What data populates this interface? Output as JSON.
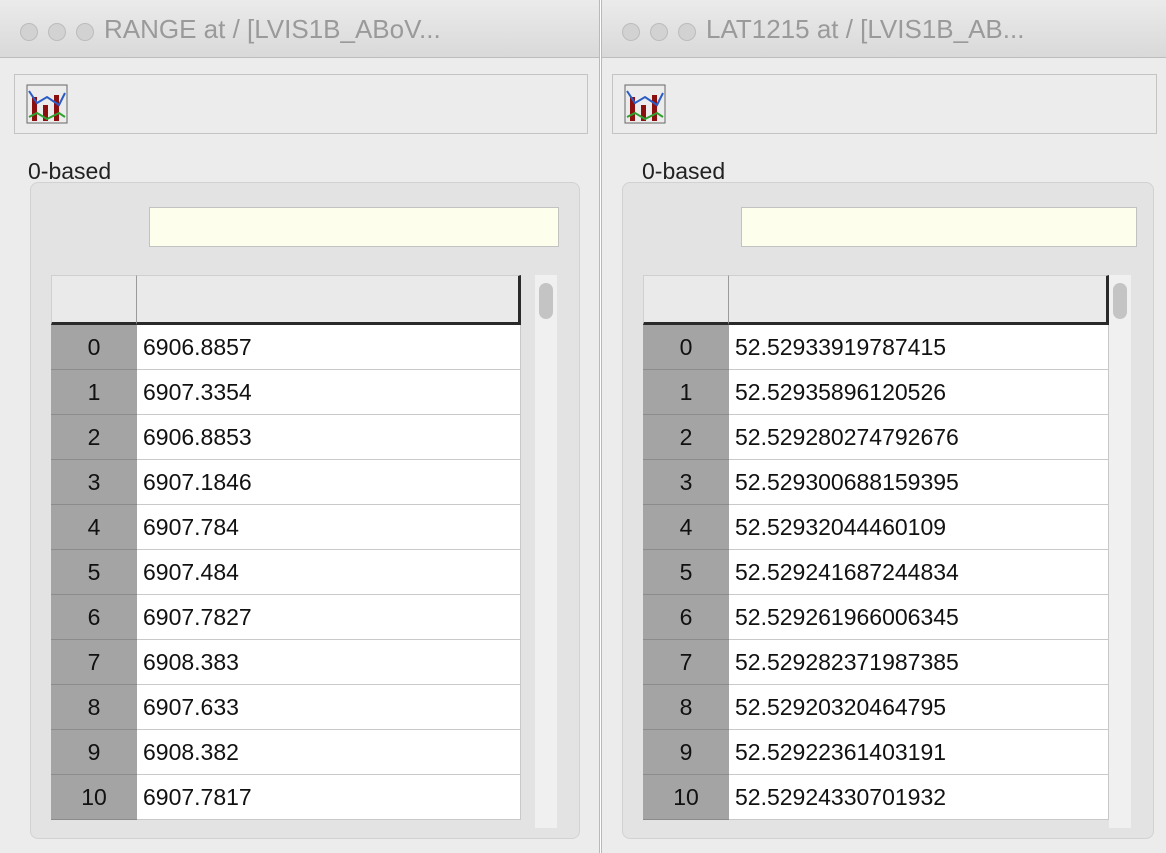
{
  "windows": [
    {
      "title": "RANGE  at  /  [LVIS1B_ABoV...",
      "index_mode": "0-based",
      "filter_value": "",
      "rows": [
        {
          "index": "0",
          "value": "6906.8857"
        },
        {
          "index": "1",
          "value": "6907.3354"
        },
        {
          "index": "2",
          "value": "6906.8853"
        },
        {
          "index": "3",
          "value": "6907.1846"
        },
        {
          "index": "4",
          "value": "6907.784"
        },
        {
          "index": "5",
          "value": "6907.484"
        },
        {
          "index": "6",
          "value": "6907.7827"
        },
        {
          "index": "7",
          "value": "6908.383"
        },
        {
          "index": "8",
          "value": "6907.633"
        },
        {
          "index": "9",
          "value": "6908.382"
        },
        {
          "index": "10",
          "value": "6907.7817"
        }
      ]
    },
    {
      "title": "LAT1215  at  /  [LVIS1B_AB...",
      "index_mode": "0-based",
      "filter_value": "",
      "rows": [
        {
          "index": "0",
          "value": "52.52933919787415"
        },
        {
          "index": "1",
          "value": "52.52935896120526"
        },
        {
          "index": "2",
          "value": "52.529280274792676"
        },
        {
          "index": "3",
          "value": "52.529300688159395"
        },
        {
          "index": "4",
          "value": "52.52932044460109"
        },
        {
          "index": "5",
          "value": "52.529241687244834"
        },
        {
          "index": "6",
          "value": "52.529261966006345"
        },
        {
          "index": "7",
          "value": "52.529282371987385"
        },
        {
          "index": "8",
          "value": "52.52920320464795"
        },
        {
          "index": "9",
          "value": "52.52922361403191"
        },
        {
          "index": "10",
          "value": "52.52924330701932"
        }
      ]
    }
  ],
  "icons": {
    "toolbar_chart": "line-bar-chart-icon",
    "window_controls": [
      "close-icon",
      "minimize-icon",
      "zoom-icon"
    ]
  },
  "colors": {
    "window_bg": "#ececec",
    "filter_bg": "#fdfeec",
    "index_cell_bg": "#a4a4a4",
    "title_text": "#9a9a9a"
  }
}
